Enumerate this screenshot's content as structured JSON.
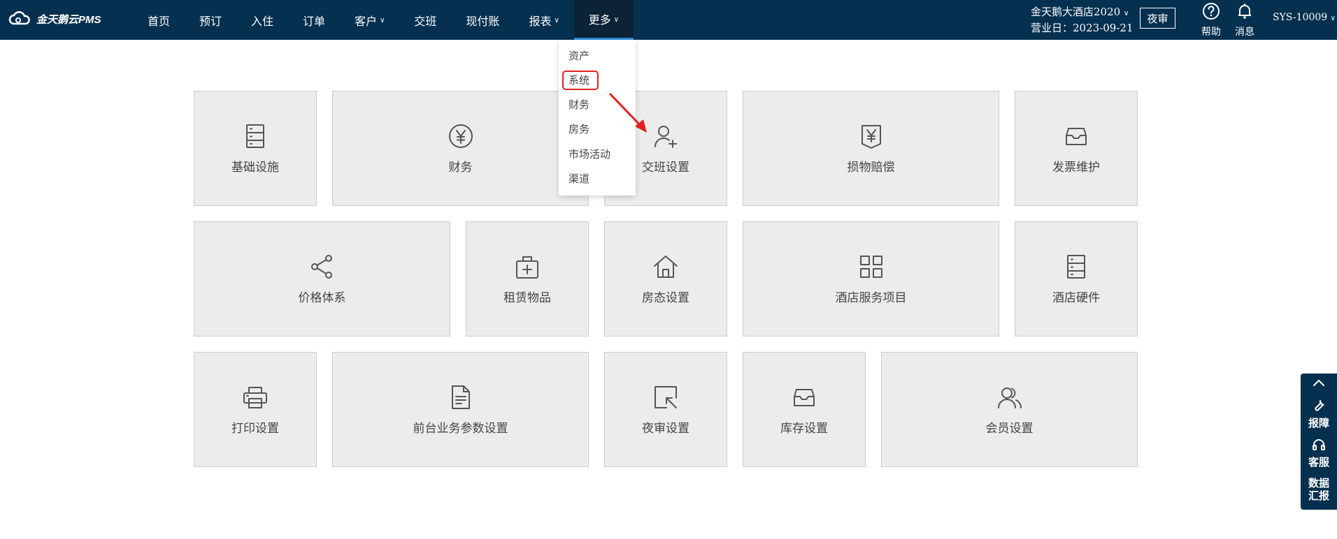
{
  "app": {
    "logo_text": "金天鹅云PMS"
  },
  "nav": {
    "items": [
      {
        "label": "首页",
        "chevron": false
      },
      {
        "label": "预订",
        "chevron": false
      },
      {
        "label": "入住",
        "chevron": false
      },
      {
        "label": "订单",
        "chevron": false
      },
      {
        "label": "客户",
        "chevron": true
      },
      {
        "label": "交班",
        "chevron": false
      },
      {
        "label": "现付账",
        "chevron": false
      },
      {
        "label": "报表",
        "chevron": true
      },
      {
        "label": "更多",
        "chevron": true,
        "active": true
      }
    ]
  },
  "header": {
    "hotel_name": "金天鹅大酒店2020",
    "business_date_label": "营业日：",
    "business_date": "2023-09-21",
    "night_audit_button": "夜审",
    "help_label": "帮助",
    "messages_label": "消息",
    "user": "SYS-10009"
  },
  "dropdown": {
    "items": [
      "资产",
      "系统",
      "财务",
      "房务",
      "市场活动",
      "渠道"
    ],
    "highlighted": "系统"
  },
  "tiles": [
    {
      "label": "基础设施",
      "icon": "server-icon"
    },
    {
      "label": "财务",
      "icon": "yen-circle-icon"
    },
    {
      "label": "交班设置",
      "icon": "user-plus-icon"
    },
    {
      "label": "损物赔偿",
      "icon": "yen-tag-icon"
    },
    {
      "label": "发票维护",
      "icon": "inbox-icon"
    },
    {
      "label": "价格体系",
      "icon": "share-icon"
    },
    {
      "label": "租赁物品",
      "icon": "medkit-icon"
    },
    {
      "label": "房态设置",
      "icon": "home-icon"
    },
    {
      "label": "酒店服务项目",
      "icon": "grid-icon"
    },
    {
      "label": "酒店硬件",
      "icon": "server-icon"
    },
    {
      "label": "打印设置",
      "icon": "printer-icon"
    },
    {
      "label": "前台业务参数设置",
      "icon": "document-icon"
    },
    {
      "label": "夜审设置",
      "icon": "cursor-box-icon"
    },
    {
      "label": "库存设置",
      "icon": "inbox-icon"
    },
    {
      "label": "会员设置",
      "icon": "users-icon"
    }
  ],
  "side_panel": {
    "items": [
      {
        "label": "报障",
        "icon": "wrench-icon"
      },
      {
        "label": "客服",
        "icon": "headset-icon"
      },
      {
        "label": "数据\n汇报",
        "icon": ""
      }
    ]
  },
  "colors": {
    "header_bg": "#06304f",
    "tile_bg": "#ececec",
    "highlight": "#e02020",
    "active_underline": "#2f8bd6"
  }
}
